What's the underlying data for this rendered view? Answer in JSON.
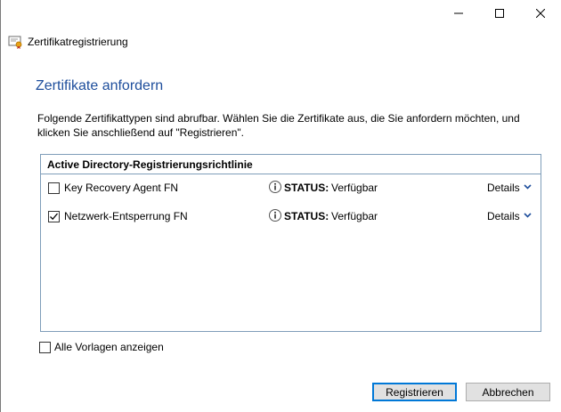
{
  "window": {
    "title": "Zertifikatregistrierung",
    "app_icon": "certificate-icon",
    "caption_icons": [
      "minimize-icon",
      "maximize-icon",
      "close-icon"
    ]
  },
  "page": {
    "heading": "Zertifikate anfordern",
    "description": "Folgende Zertifikattypen sind abrufbar. Wählen Sie die Zertifikate aus, die Sie anfordern möchten, und klicken Sie anschließend auf \"Registrieren\"."
  },
  "policy": {
    "header": "Active Directory-Registrierungsrichtlinie",
    "templates": [
      {
        "name": "Key Recovery Agent FN",
        "checked": false,
        "status_label": "STATUS:",
        "status": "Verfügbar",
        "details_label": "Details"
      },
      {
        "name": "Netzwerk-Entsperrung FN",
        "checked": true,
        "status_label": "STATUS:",
        "status": "Verfügbar",
        "details_label": "Details"
      }
    ]
  },
  "footer": {
    "show_all_label": "Alle Vorlagen anzeigen",
    "show_all_checked": false
  },
  "buttons": {
    "register": "Registrieren",
    "cancel": "Abbrechen"
  },
  "colors": {
    "heading": "#1e4e9c",
    "accent": "#0078d7",
    "list_border": "#7f9db9"
  }
}
